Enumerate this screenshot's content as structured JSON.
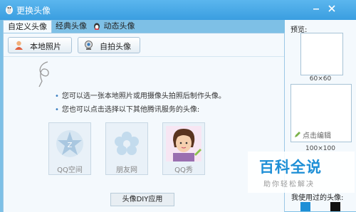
{
  "window": {
    "title": "更换头像"
  },
  "tabs": [
    {
      "label": "自定义头像"
    },
    {
      "label": "经典头像"
    },
    {
      "label": "动态头像"
    }
  ],
  "toolbar": {
    "local_photo": "本地照片",
    "selfie": "自拍头像"
  },
  "hints": {
    "line1": "您可以选一张本地照片或用摄像头拍照后制作头像。",
    "line2": "您也可以点击选择以下其他腾讯服务的头像:"
  },
  "services": [
    {
      "label": "QQ空间",
      "icon": "qzone-icon"
    },
    {
      "label": "朋友网",
      "icon": "pengyou-icon"
    },
    {
      "label": "QQ秀",
      "icon": "qqshow-icon"
    }
  ],
  "diy_button": "头像DIY应用",
  "preview": {
    "label": "预览:",
    "size_60": "60×60",
    "size_100": "100×100",
    "edit_link": "点击编辑",
    "used_label": "我使用过的头像:"
  },
  "watermark": {
    "main": "百科全说",
    "sub": "助你轻松解决"
  },
  "colors": {
    "titlebar": "#3a9ee0",
    "accent": "#1e8fd6"
  }
}
